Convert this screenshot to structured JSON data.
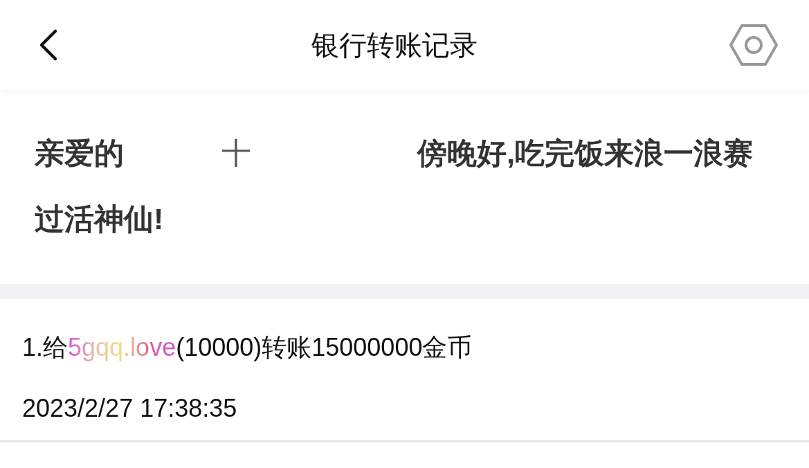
{
  "header": {
    "title": "银行转账记录"
  },
  "notice": {
    "parts": [
      {
        "kind": "plain",
        "text": "亲爱的"
      },
      {
        "kind": "muted",
        "text": "十"
      },
      {
        "kind": "plain",
        "text": "傍晚好,吃完饭来浪一浪赛过活神仙!"
      }
    ]
  },
  "records": [
    {
      "parts": [
        {
          "kind": "plain",
          "text": "1.给"
        },
        {
          "kind": "gradient",
          "text": "5gqq.love"
        },
        {
          "kind": "plain",
          "text": "(10000)转账15000000金币"
        }
      ],
      "time": "2023/2/27 17:38:35"
    }
  ]
}
